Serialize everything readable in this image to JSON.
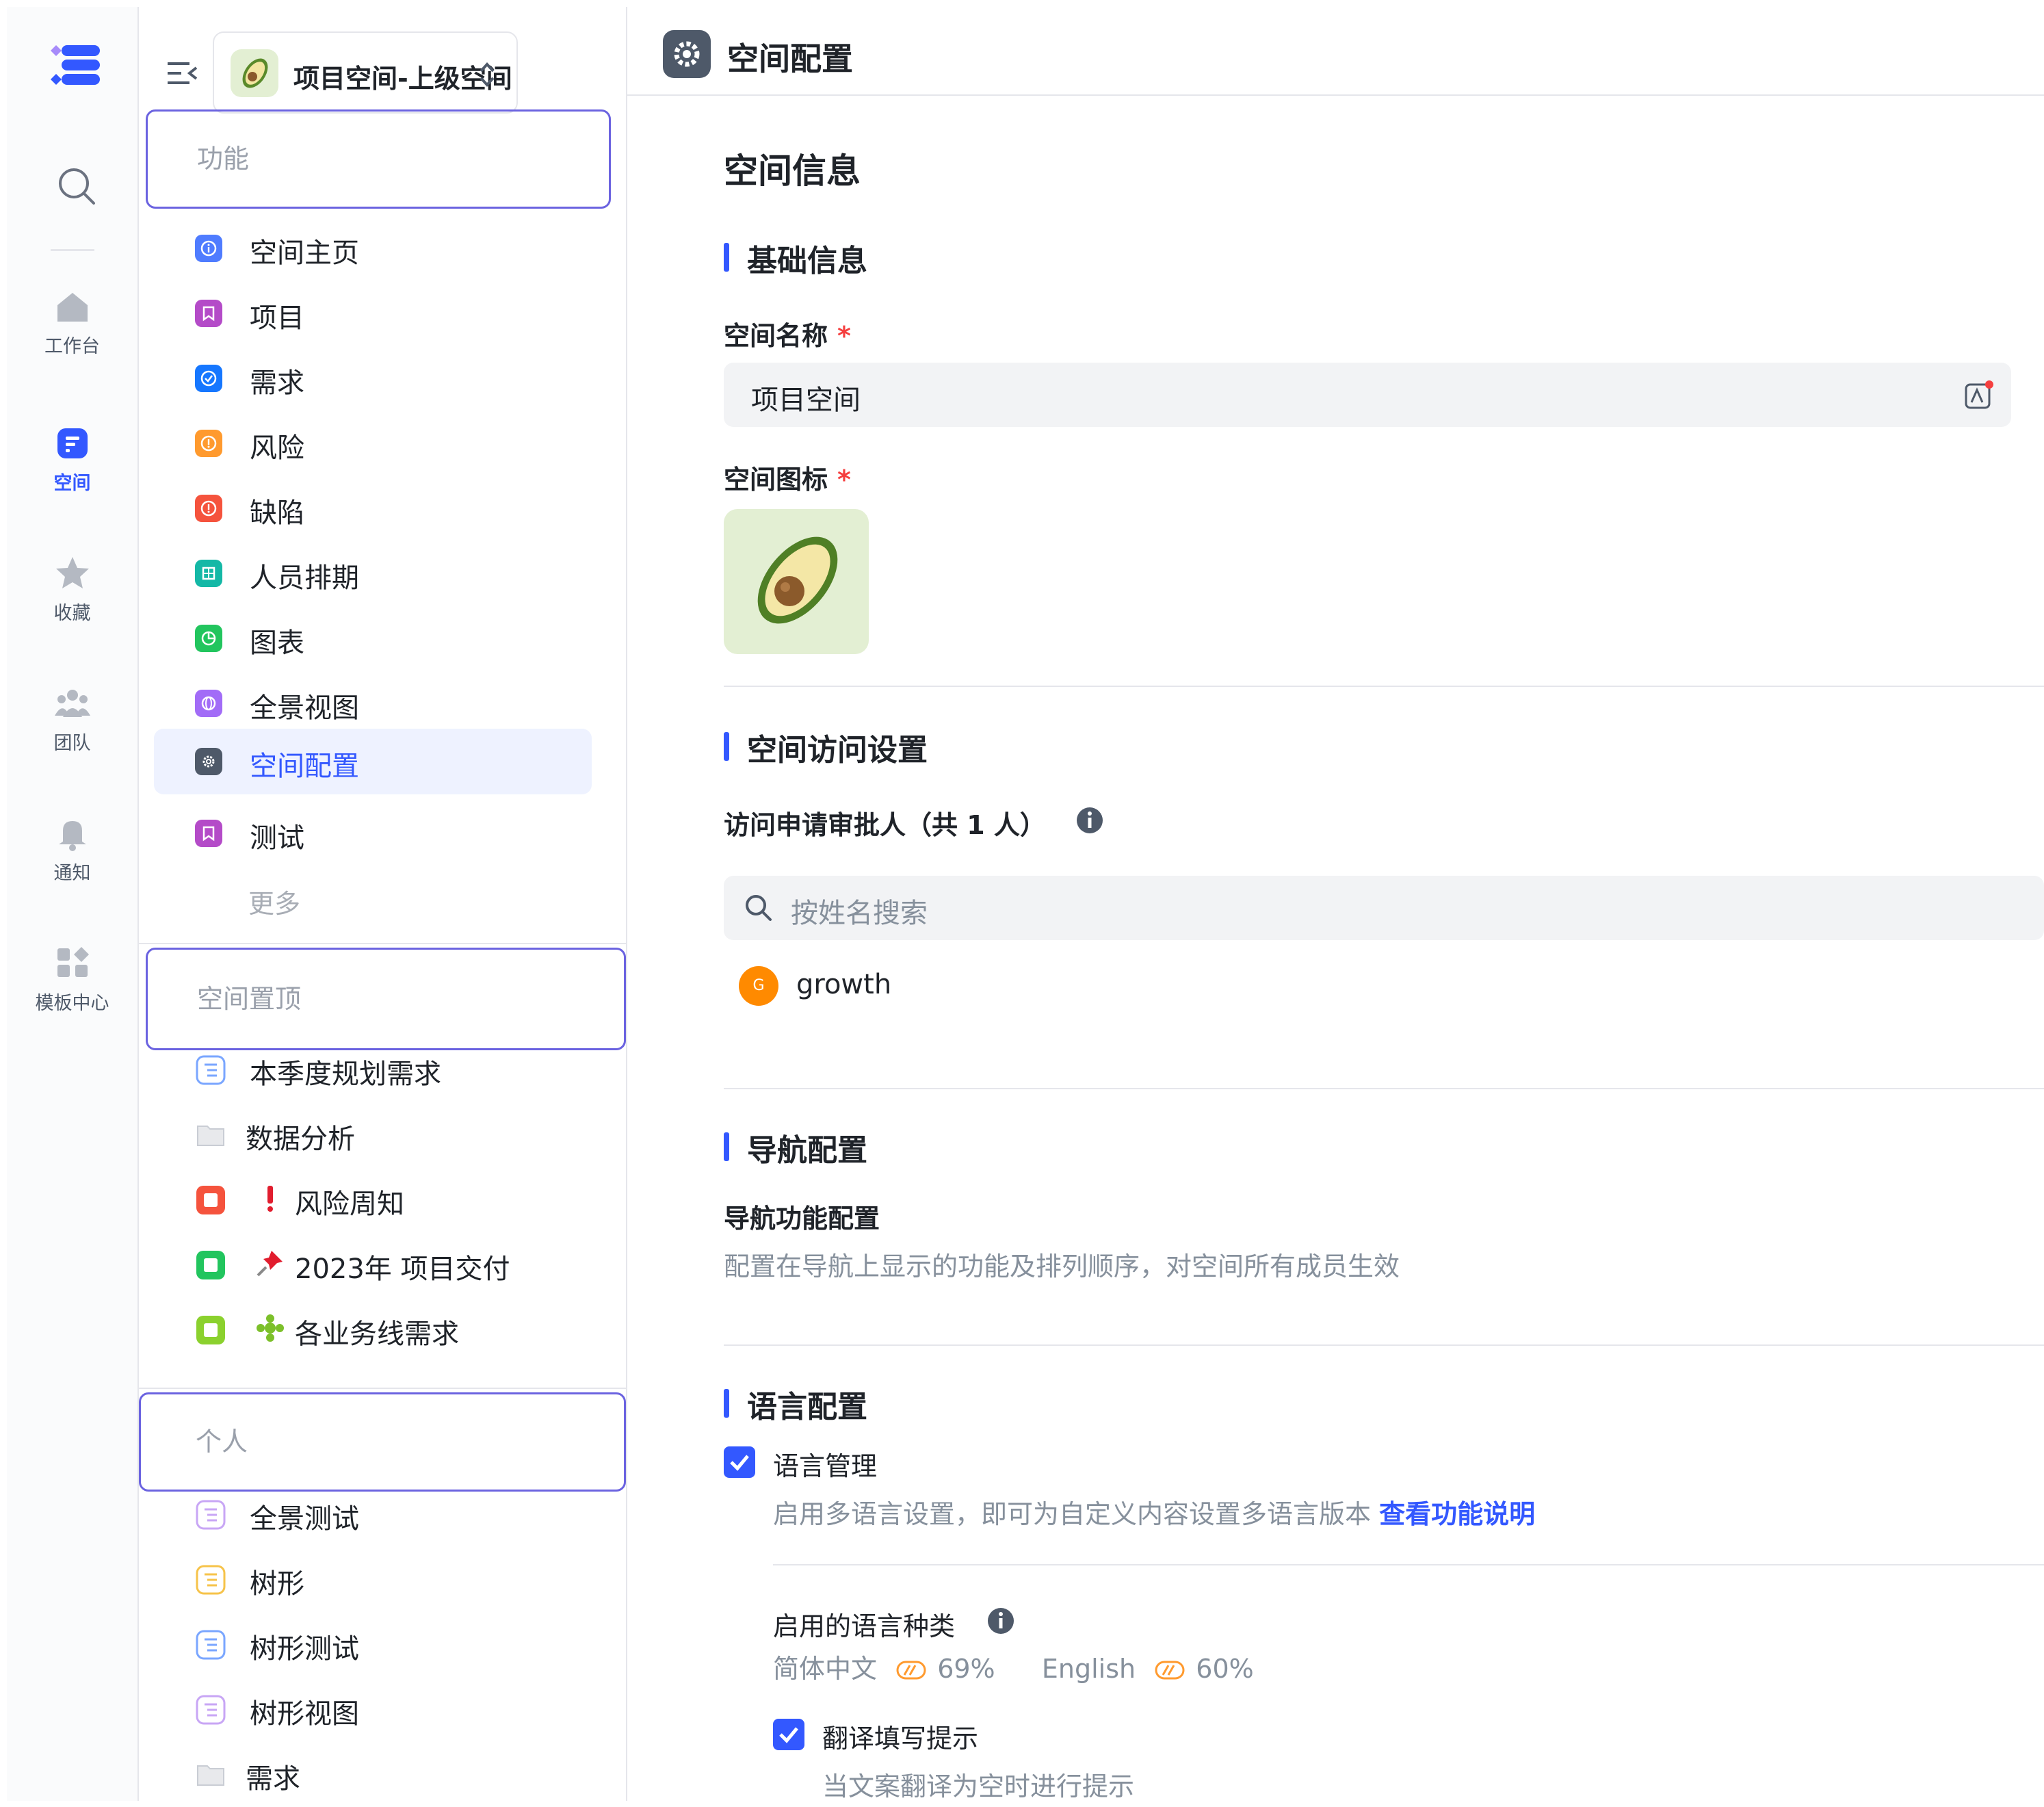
{
  "rail": {
    "items": [
      {
        "label": "工作台",
        "icon": "home-icon"
      },
      {
        "label": "空间",
        "icon": "space-icon",
        "active": true
      },
      {
        "label": "收藏",
        "icon": "star-icon"
      },
      {
        "label": "团队",
        "icon": "team-icon"
      },
      {
        "label": "通知",
        "icon": "bell-icon"
      },
      {
        "label": "模板中心",
        "icon": "template-icon"
      }
    ]
  },
  "nav": {
    "space_name": "项目空间-上级空间",
    "groups": {
      "features": "功能",
      "pinned": "空间置顶",
      "personal": "个人"
    },
    "feature_items": [
      {
        "label": "空间主页",
        "color": "#4f7cff"
      },
      {
        "label": "项目",
        "color": "#b44bc8"
      },
      {
        "label": "需求",
        "color": "#1677ff"
      },
      {
        "label": "风险",
        "color": "#ff9a2e"
      },
      {
        "label": "缺陷",
        "color": "#f5533d"
      },
      {
        "label": "人员排期",
        "color": "#14b8a6"
      },
      {
        "label": "图表",
        "color": "#22c55e"
      },
      {
        "label": "全景视图",
        "color": "#a26cf7"
      },
      {
        "label": "空间配置",
        "color": "#4e5969",
        "active": true
      },
      {
        "label": "测试",
        "color": "#b44bc8"
      }
    ],
    "more": "更多",
    "pinned_items": [
      {
        "label": "本季度规划需求",
        "icon": "list-icon"
      },
      {
        "label": "数据分析",
        "icon": "folder-icon"
      },
      {
        "label": "风险周知",
        "icon": "red-square-icon",
        "emoji": "!"
      },
      {
        "label": "2023年 项目交付",
        "icon": "green-square-icon",
        "emoji": "pin"
      },
      {
        "label": "各业务线需求",
        "icon": "lime-square-icon",
        "emoji": "puzzle"
      }
    ],
    "personal_items": [
      {
        "label": "全景测试",
        "icon": "list-icon"
      },
      {
        "label": "树形",
        "icon": "list-icon"
      },
      {
        "label": "树形测试",
        "icon": "list-icon"
      },
      {
        "label": "树形视图",
        "icon": "list-icon"
      },
      {
        "label": "需求",
        "icon": "folder-icon"
      }
    ]
  },
  "topbar": {
    "title": "空间配置"
  },
  "main": {
    "page_title": "空间信息",
    "basic": {
      "title": "基础信息",
      "name_label": "空间名称",
      "name_value": "项目空间",
      "icon_label": "空间图标",
      "required_mark": "*"
    },
    "access": {
      "title": "空间访问设置",
      "approver_label": "访问申请审批人（共 1 人）",
      "search_placeholder": "按姓名搜索",
      "user_initial": "G",
      "user_name": "growth"
    },
    "navigation": {
      "title": "导航配置",
      "sub_label": "导航功能配置",
      "desc": "配置在导航上显示的功能及排列顺序，对空间所有成员生效"
    },
    "language": {
      "title": "语言配置",
      "manage_label": "语言管理",
      "manage_desc": "启用多语言设置，即可为自定义内容设置多语言版本",
      "manage_link": "查看功能说明",
      "enabled_label": "启用的语言种类",
      "lang1": "简体中文",
      "lang1_pct": "69%",
      "lang2": "English",
      "lang2_pct": "60%",
      "hint_label": "翻译填写提示",
      "hint_desc": "当文案翻译为空时进行提示"
    }
  }
}
